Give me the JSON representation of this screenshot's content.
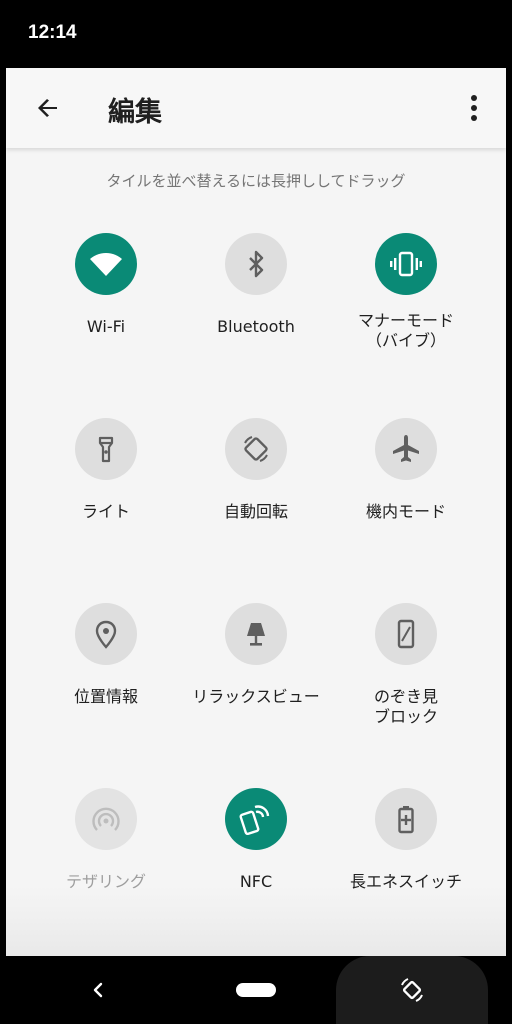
{
  "status_bar": {
    "time": "12:14"
  },
  "app_bar": {
    "title": "編集"
  },
  "hint": "タイルを並べ替えるには長押ししてドラッグ",
  "tiles": [
    {
      "label": "Wi-Fi",
      "icon": "wifi-icon",
      "state": "active"
    },
    {
      "label": "Bluetooth",
      "icon": "bluetooth-icon",
      "state": "inactive"
    },
    {
      "label": "マナーモード\n（バイブ）",
      "icon": "vibrate-icon",
      "state": "active"
    },
    {
      "label": "ライト",
      "icon": "flashlight-icon",
      "state": "inactive"
    },
    {
      "label": "自動回転",
      "icon": "auto-rotate-icon",
      "state": "inactive"
    },
    {
      "label": "機内モード",
      "icon": "airplane-icon",
      "state": "inactive"
    },
    {
      "label": "位置情報",
      "icon": "location-icon",
      "state": "inactive"
    },
    {
      "label": "リラックスビュー",
      "icon": "lamp-icon",
      "state": "inactive"
    },
    {
      "label": "のぞき見\nブロック",
      "icon": "privacy-screen-icon",
      "state": "inactive"
    },
    {
      "label": "テザリング",
      "icon": "hotspot-icon",
      "state": "unavailable"
    },
    {
      "label": "NFC",
      "icon": "nfc-icon",
      "state": "active"
    },
    {
      "label": "長エネスイッチ",
      "icon": "battery-saver-icon",
      "state": "inactive"
    }
  ],
  "colors": {
    "active_tile": "#0a8a76",
    "inactive_tile": "#dedede",
    "inactive_icon": "#5f5f5f",
    "active_icon": "#ffffff"
  }
}
